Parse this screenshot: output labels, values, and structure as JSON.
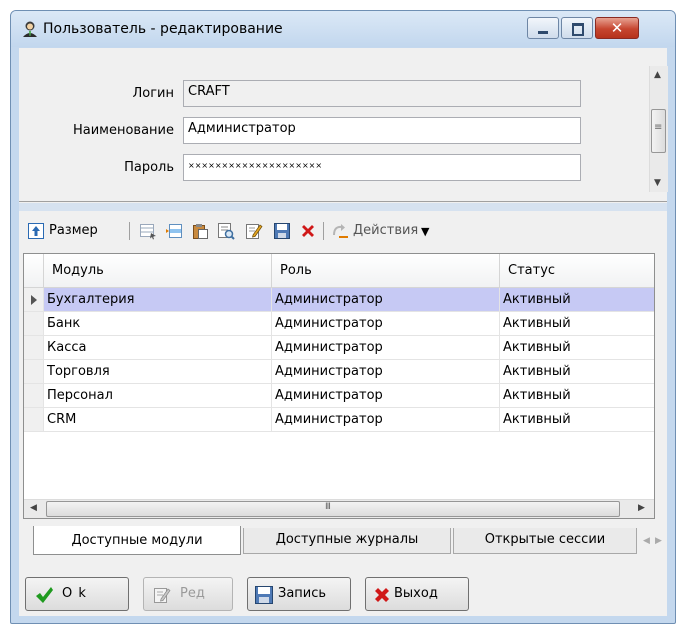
{
  "window": {
    "title": "Пользователь - редактирование",
    "close_glyph": "✕"
  },
  "form": {
    "login_label": "Логин",
    "login_value": "CRAFT",
    "name_label": "Наименование",
    "name_value": "Администратор",
    "password_label": "Пароль",
    "password_value": "××××××××××××××××××××"
  },
  "toolbar": {
    "size_label": "Размер",
    "actions_label": "Действия"
  },
  "grid": {
    "columns": [
      "Модуль",
      "Роль",
      "Статус"
    ],
    "rows": [
      [
        "Бухгалтерия",
        "Администратор",
        "Активный"
      ],
      [
        "Банк",
        "Администратор",
        "Активный"
      ],
      [
        "Касса",
        "Администратор",
        "Активный"
      ],
      [
        "Торговля",
        "Администратор",
        "Активный"
      ],
      [
        "Персонал",
        "Администратор",
        "Активный"
      ],
      [
        "CRM",
        "Администратор",
        "Активный"
      ]
    ],
    "selected_row": 0
  },
  "tabs": [
    "Доступные модули",
    "Доступные журналы",
    "Открытые сессии"
  ],
  "buttons": {
    "ok": "O k",
    "edit": "Ред",
    "save": "Запись",
    "exit": "Выход"
  },
  "colors": {
    "selection": "#c6c9f4",
    "accent_delete": "#d01818",
    "ok_green": "#1f9a1f"
  }
}
